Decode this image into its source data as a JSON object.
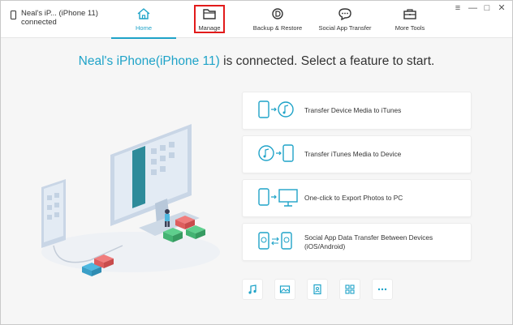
{
  "device": {
    "name_line1": "Neal's iP... (iPhone 11)",
    "name_line2": "connected"
  },
  "nav": [
    {
      "label": "Home"
    },
    {
      "label": "Manage"
    },
    {
      "label": "Backup & Restore"
    },
    {
      "label": "Social App Transfer"
    },
    {
      "label": "More Tools"
    }
  ],
  "window_controls": {
    "menu": "≡",
    "minimize": "—",
    "maximize": "□",
    "close": "✕"
  },
  "headline": {
    "device": "Neal's iPhone(iPhone 11)",
    "rest": " is connected. Select a feature to start."
  },
  "features": [
    {
      "label": "Transfer Device Media to iTunes"
    },
    {
      "label": "Transfer iTunes Media to Device"
    },
    {
      "label": "One-click to Export Photos to PC"
    },
    {
      "label_line1": "Social App Data Transfer Between Devices",
      "label_line2": "(iOS/Android)"
    }
  ],
  "quick_icons": [
    "music-icon",
    "photo-icon",
    "contacts-icon",
    "apps-icon",
    "more-icon"
  ],
  "colors": {
    "accent": "#1fa3c8",
    "highlight": "#e21b1b"
  }
}
